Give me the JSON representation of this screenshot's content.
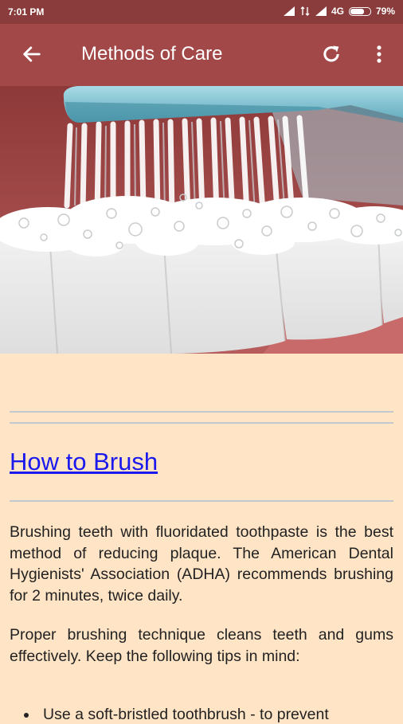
{
  "status_bar": {
    "time": "7:01 PM",
    "network": "4G",
    "battery": "79%",
    "battery_level": 0.79
  },
  "app_bar": {
    "title": "Methods of Care"
  },
  "article": {
    "heading": "How to Brush",
    "paragraphs": [
      "Brushing teeth with fluoridated toothpaste is the best method of reducing plaque. The American Dental Hygienists' Association (ADHA) recommends brushing for 2 minutes, twice daily.",
      "Proper brushing technique cleans teeth and gums effectively. Keep the following tips in mind:"
    ],
    "bullets": [
      "Use a soft-bristled toothbrush - to prevent"
    ]
  }
}
